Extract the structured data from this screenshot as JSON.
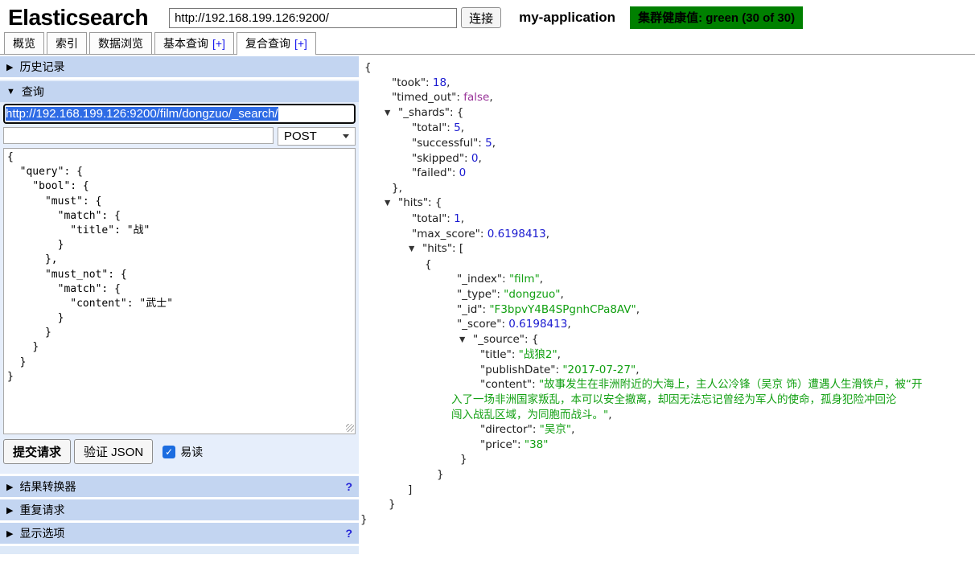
{
  "header": {
    "title": "Elasticsearch",
    "url_value": "http://192.168.199.126:9200/",
    "connect_label": "连接",
    "cluster_name": "my-application",
    "health_label": "集群健康值: green (30 of 30)",
    "health_color": "#008000"
  },
  "tabs": [
    {
      "name": "overview",
      "label": "概览"
    },
    {
      "name": "indices",
      "label": "索引"
    },
    {
      "name": "data-browser",
      "label": "数据浏览"
    },
    {
      "name": "basic-query",
      "label": "基本查询",
      "plus": "[+]"
    },
    {
      "name": "compound-query",
      "label": "复合查询",
      "plus": "[+]",
      "active": true
    }
  ],
  "panel": {
    "history": {
      "label": "历史记录"
    },
    "query": {
      "label": "查询",
      "url_value": "http://192.168.199.126:9200/film/dongzuo/_search/",
      "method": "POST",
      "body": "{\n  \"query\": {\n    \"bool\": {\n      \"must\": {\n        \"match\": {\n          \"title\": \"战\"\n        }\n      },\n      \"must_not\": {\n        \"match\": {\n          \"content\": \"武士\"\n        }\n      }\n    }\n  }\n}"
    },
    "submit_label": "提交请求",
    "validate_label": "验证 JSON",
    "readable_label": "易读",
    "readable_checked": true,
    "check_glyph": "✓",
    "transformer": {
      "label": "结果转换器",
      "help": "?"
    },
    "repeat": {
      "label": "重复请求"
    },
    "options": {
      "label": "显示选项",
      "help": "?"
    }
  },
  "results": {
    "lines": [
      {
        "p": 7,
        "s": [
          [
            "{",
            "k"
          ]
        ]
      },
      {
        "p": 41,
        "s": [
          [
            "\"took\": ",
            "k"
          ],
          [
            "18",
            "n"
          ],
          [
            ",",
            "k"
          ]
        ]
      },
      {
        "p": 41,
        "s": [
          [
            "\"timed_out\": ",
            "k"
          ],
          [
            "false",
            "b"
          ],
          [
            ",",
            "k"
          ]
        ]
      },
      {
        "p": 32,
        "a": true,
        "s": [
          [
            "\"_shards\": {",
            "k"
          ]
        ]
      },
      {
        "p": 66,
        "s": [
          [
            "\"total\": ",
            "k"
          ],
          [
            "5",
            "n"
          ],
          [
            ",",
            "k"
          ]
        ]
      },
      {
        "p": 66,
        "s": [
          [
            "\"successful\": ",
            "k"
          ],
          [
            "5",
            "n"
          ],
          [
            ",",
            "k"
          ]
        ]
      },
      {
        "p": 66,
        "s": [
          [
            "\"skipped\": ",
            "k"
          ],
          [
            "0",
            "n"
          ],
          [
            ",",
            "k"
          ]
        ]
      },
      {
        "p": 66,
        "s": [
          [
            "\"failed\": ",
            "k"
          ],
          [
            "0",
            "n"
          ]
        ]
      },
      {
        "p": 41,
        "s": [
          [
            "},",
            "k"
          ]
        ]
      },
      {
        "p": 32,
        "a": true,
        "s": [
          [
            "\"hits\": {",
            "k"
          ]
        ]
      },
      {
        "p": 66,
        "s": [
          [
            "\"total\": ",
            "k"
          ],
          [
            "1",
            "n"
          ],
          [
            ",",
            "k"
          ]
        ]
      },
      {
        "p": 66,
        "s": [
          [
            "\"max_score\": ",
            "k"
          ],
          [
            "0.6198413",
            "n"
          ],
          [
            ",",
            "k"
          ]
        ]
      },
      {
        "p": 62,
        "a": true,
        "s": [
          [
            "\"hits\": [",
            "k"
          ]
        ]
      },
      {
        "p": 82,
        "s": [
          [
            "{",
            "k"
          ]
        ]
      },
      {
        "p": 122,
        "s": [
          [
            "\"_index\": ",
            "k"
          ],
          [
            "\"film\"",
            "s"
          ],
          [
            ",",
            "k"
          ]
        ]
      },
      {
        "p": 122,
        "s": [
          [
            "\"_type\": ",
            "k"
          ],
          [
            "\"dongzuo\"",
            "s"
          ],
          [
            ",",
            "k"
          ]
        ]
      },
      {
        "p": 122,
        "s": [
          [
            "\"_id\": ",
            "k"
          ],
          [
            "\"F3bpvY4B4SPgnhCPa8AV\"",
            "s"
          ],
          [
            ",",
            "k"
          ]
        ]
      },
      {
        "p": 122,
        "s": [
          [
            "\"_score\": ",
            "k"
          ],
          [
            "0.6198413",
            "n"
          ],
          [
            ",",
            "k"
          ]
        ]
      },
      {
        "p": 125,
        "a": true,
        "s": [
          [
            "\"_source\": {",
            "k"
          ]
        ]
      },
      {
        "p": 151,
        "s": [
          [
            "\"title\": ",
            "k"
          ],
          [
            "\"战狼2\"",
            "s"
          ],
          [
            ",",
            "k"
          ]
        ]
      },
      {
        "p": 151,
        "s": [
          [
            "\"publishDate\": ",
            "k"
          ],
          [
            "\"2017-07-27\"",
            "s"
          ],
          [
            ",",
            "k"
          ]
        ]
      },
      {
        "p": 151,
        "s": [
          [
            "\"content\": ",
            "k"
          ],
          [
            "\"故事发生在非洲附近的大海上，主人公冷锋（吴京 饰）遭遇人生滑铁卢，被“开",
            "s"
          ]
        ]
      },
      {
        "p": 115,
        "s": [
          [
            "入了一场非洲国家叛乱，本可以安全撤离，却因无法忘记曾经为军人的使命，孤身犯险冲回沦",
            "s"
          ]
        ]
      },
      {
        "p": 115,
        "s": [
          [
            "闯入战乱区域，为同胞而战斗。\"",
            "s"
          ],
          [
            ",",
            "k"
          ]
        ]
      },
      {
        "p": 151,
        "s": [
          [
            "\"director\": ",
            "k"
          ],
          [
            "\"吴京\"",
            "s"
          ],
          [
            ",",
            "k"
          ]
        ]
      },
      {
        "p": 151,
        "s": [
          [
            "\"price\": ",
            "k"
          ],
          [
            "\"38\"",
            "s"
          ]
        ]
      },
      {
        "p": 126,
        "s": [
          [
            "}",
            "k"
          ]
        ]
      },
      {
        "p": 97,
        "s": [
          [
            "}",
            "k"
          ]
        ]
      },
      {
        "p": 61,
        "s": [
          [
            "]",
            "k"
          ]
        ]
      },
      {
        "p": 37,
        "s": [
          [
            "}",
            "k"
          ]
        ]
      },
      {
        "p": 2,
        "s": [
          [
            "}",
            "k"
          ]
        ]
      }
    ]
  }
}
